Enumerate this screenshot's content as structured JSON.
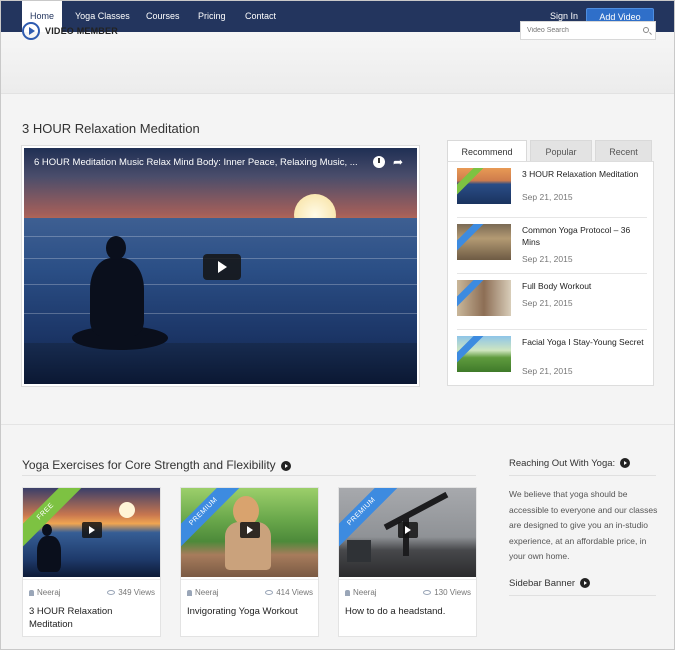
{
  "nav": {
    "items": [
      {
        "label": "Home",
        "active": true
      },
      {
        "label": "Yoga Classes"
      },
      {
        "label": "Courses"
      },
      {
        "label": "Pricing"
      },
      {
        "label": "Contact"
      }
    ],
    "sign_in": "Sign In",
    "add_video": "Add Video",
    "color": "#23355e",
    "accent": "#2f6fc9"
  },
  "header": {
    "logo_text": "VIDEO MEMBER",
    "search_placeholder": "Video Search"
  },
  "main": {
    "title": "3 HOUR Relaxation Meditation",
    "video_title": "6 HOUR Meditation Music Relax Mind Body: Inner Peace, Relaxing Music, ..."
  },
  "tabs": {
    "labels": [
      "Recommend",
      "Popular",
      "Recent"
    ],
    "active": "Recommend",
    "items": [
      {
        "title": "3 HOUR Relaxation Meditation",
        "date": "Sep 21, 2015",
        "ribbon_color": "#7dc242"
      },
      {
        "title": "Common Yoga Protocol – 36 Mins",
        "date": "Sep 21, 2015",
        "ribbon_color": "#3d8be0"
      },
      {
        "title": "Full Body Workout",
        "date": "Sep 21, 2015",
        "ribbon_color": "#3d8be0"
      },
      {
        "title": "Facial Yoga I Stay-Young Secret",
        "date": "Sep 21, 2015",
        "ribbon_color": "#3d8be0"
      }
    ]
  },
  "section": {
    "title": "Yoga Exercises for Core Strength and Flexibility",
    "cards": [
      {
        "ribbon": "FREE",
        "ribbon_color": "#7dc242",
        "author": "Neeraj",
        "views": "349 Views",
        "title": "3 HOUR Relaxation Meditation"
      },
      {
        "ribbon": "PREMIUM",
        "ribbon_color": "#3d8be0",
        "author": "Neeraj",
        "views": "414 Views",
        "title": "Invigorating Yoga Workout"
      },
      {
        "ribbon": "PREMIUM",
        "ribbon_color": "#3d8be0",
        "author": "Neeraj",
        "views": "130 Views",
        "title": "How to do a headstand."
      }
    ]
  },
  "sidebar": {
    "title": "Reaching Out With Yoga:",
    "text": "We believe that yoga should be accessible to everyone and our classes are designed to give you an in-studio experience, at an affordable price, in your own home.",
    "banner_title": "Sidebar Banner"
  }
}
